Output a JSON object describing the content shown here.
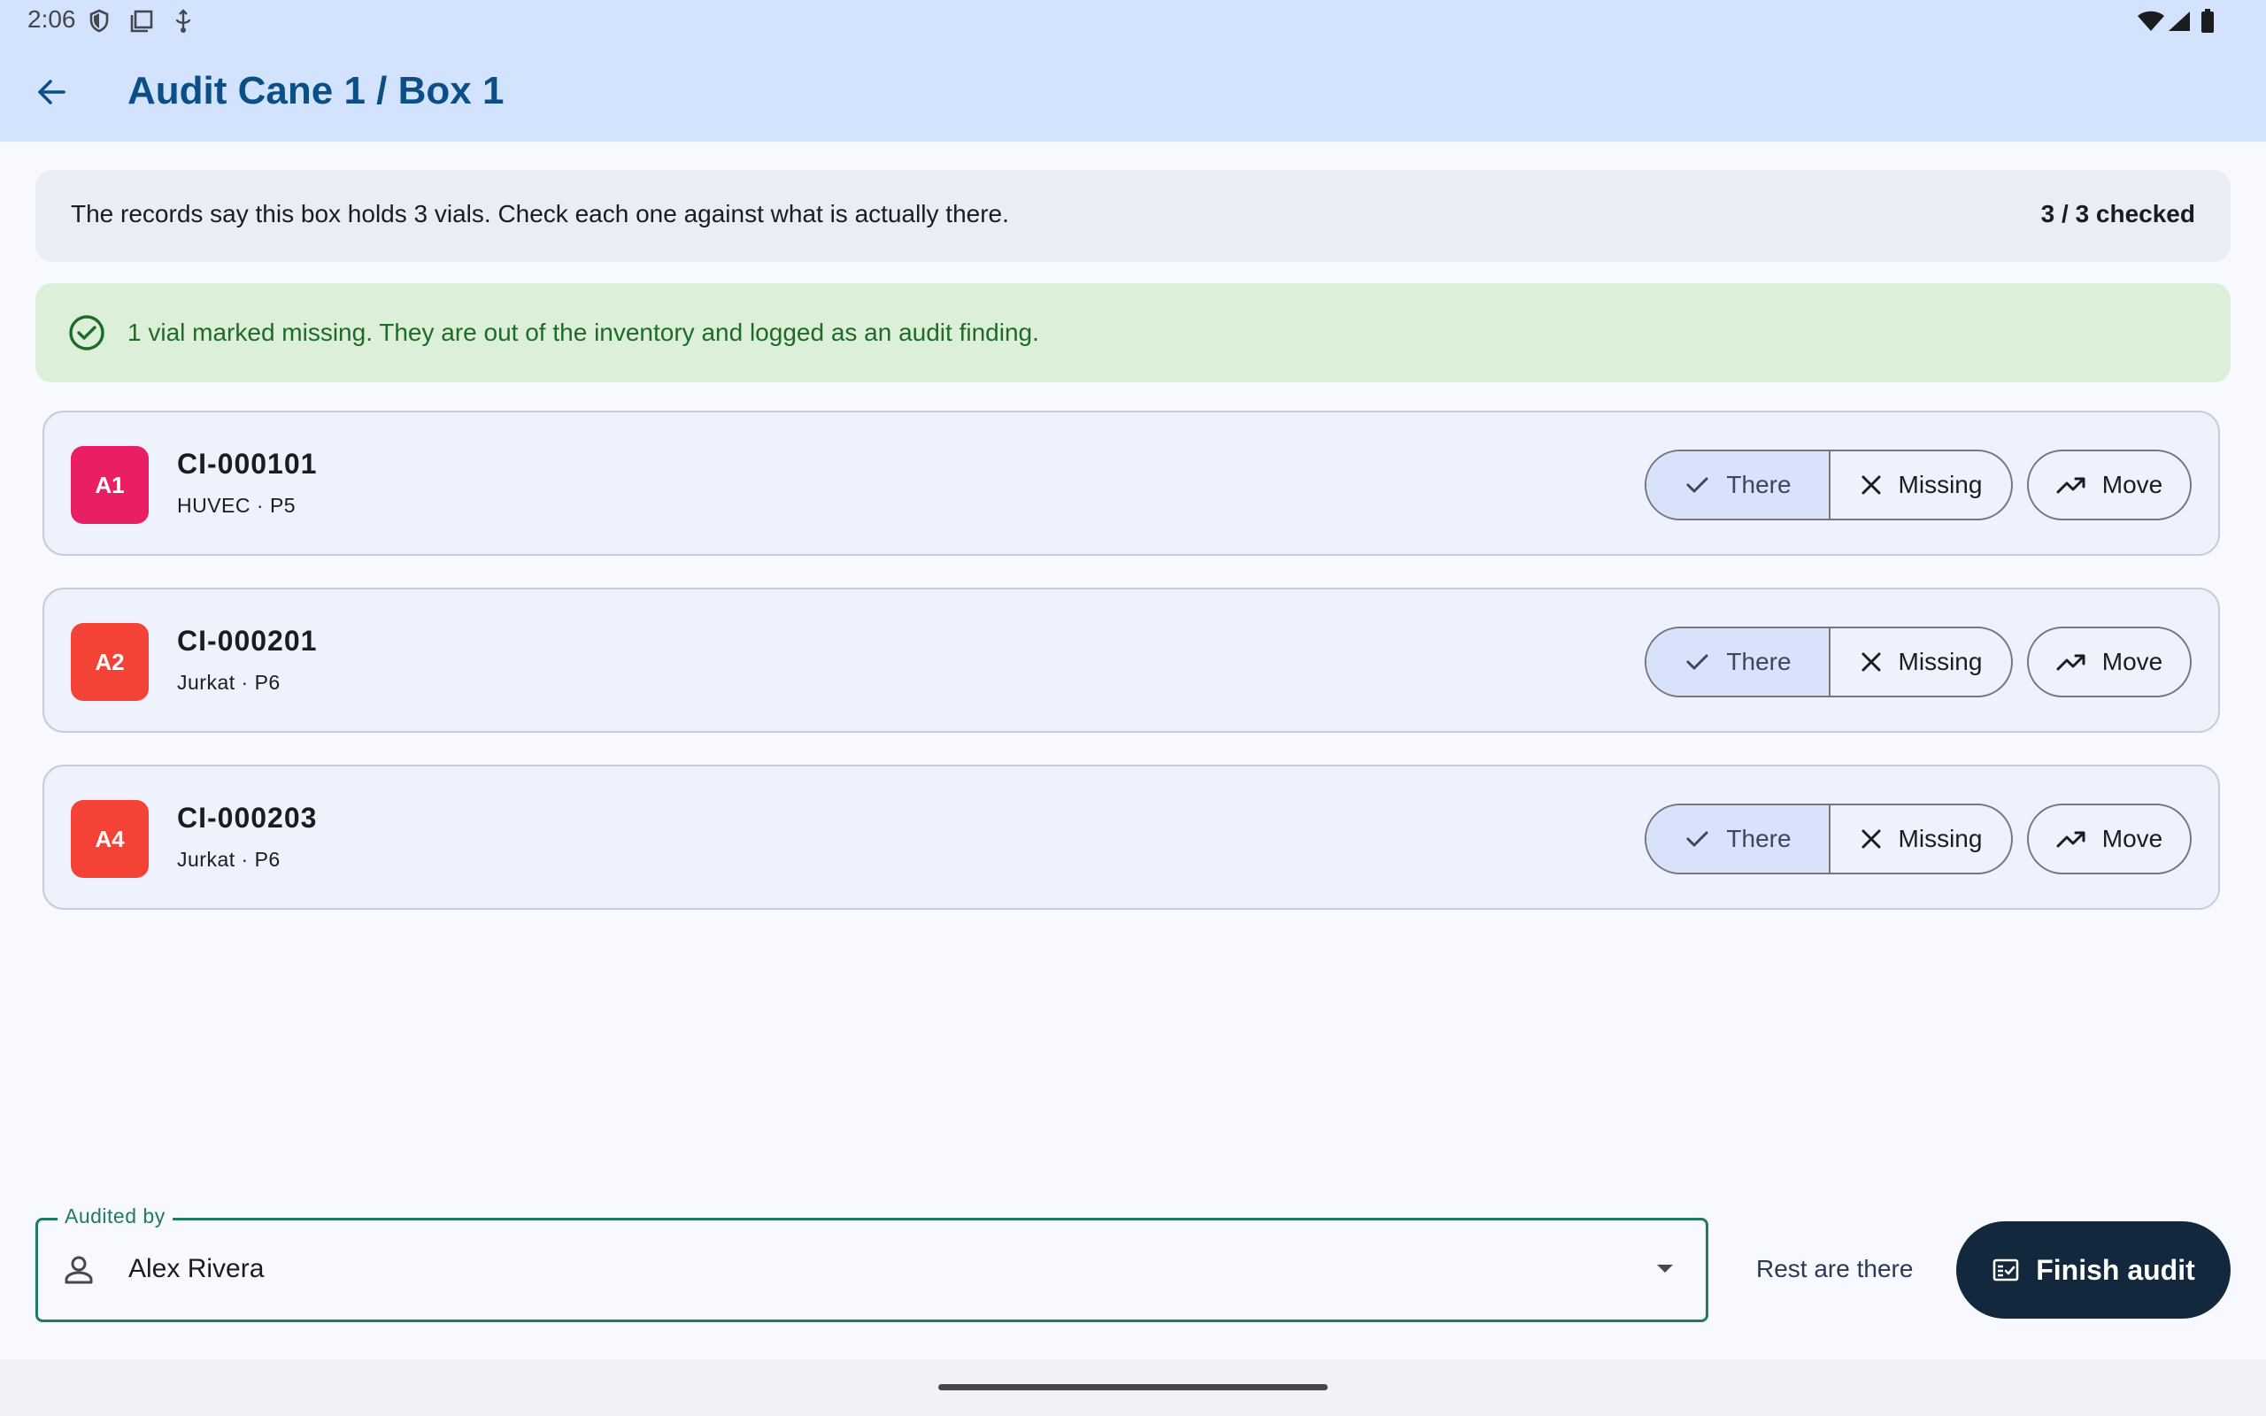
{
  "status_bar": {
    "time": "2:06",
    "icons": [
      "shield-icon",
      "screenshot-icon",
      "usb-debug-icon",
      "wifi-icon",
      "signal-icon",
      "battery-icon"
    ]
  },
  "app_bar": {
    "back_icon": "arrow-back-icon",
    "title": "Audit Cane 1 / Box 1"
  },
  "info_banner": {
    "text": "The records say this box holds 3 vials. Check each one against what is actually there.",
    "count": "3 / 3 checked"
  },
  "success_banner": {
    "icon": "check-circle-icon",
    "text": "1 vial marked missing. They are out of the inventory and logged as an audit finding."
  },
  "vials": [
    {
      "position": "A1",
      "id": "CI-000101",
      "detail": "HUVEC · P5",
      "badge_color": "#e91e63",
      "selected": "There"
    },
    {
      "position": "A2",
      "id": "CI-000201",
      "detail": "Jurkat · P6",
      "badge_color": "#f44336",
      "selected": "There"
    },
    {
      "position": "A4",
      "id": "CI-000203",
      "detail": "Jurkat · P6",
      "badge_color": "#f44336",
      "selected": "There"
    }
  ],
  "actions": {
    "there_label": "There",
    "missing_label": "Missing",
    "move_label": "Move"
  },
  "footer": {
    "audited_by_label": "Audited by",
    "audited_by_value": "Alex Rivera",
    "rest_label": "Rest are there",
    "finish_label": "Finish audit"
  },
  "colors": {
    "app_bar_bg": "#d3e3fd",
    "title": "#0b4f86",
    "selected_segment": "#d8e2fb",
    "success_bg": "#dcf0d9",
    "success_text": "#1d6b27",
    "field_outline": "#1f7a66",
    "finish_button": "#13283c"
  }
}
